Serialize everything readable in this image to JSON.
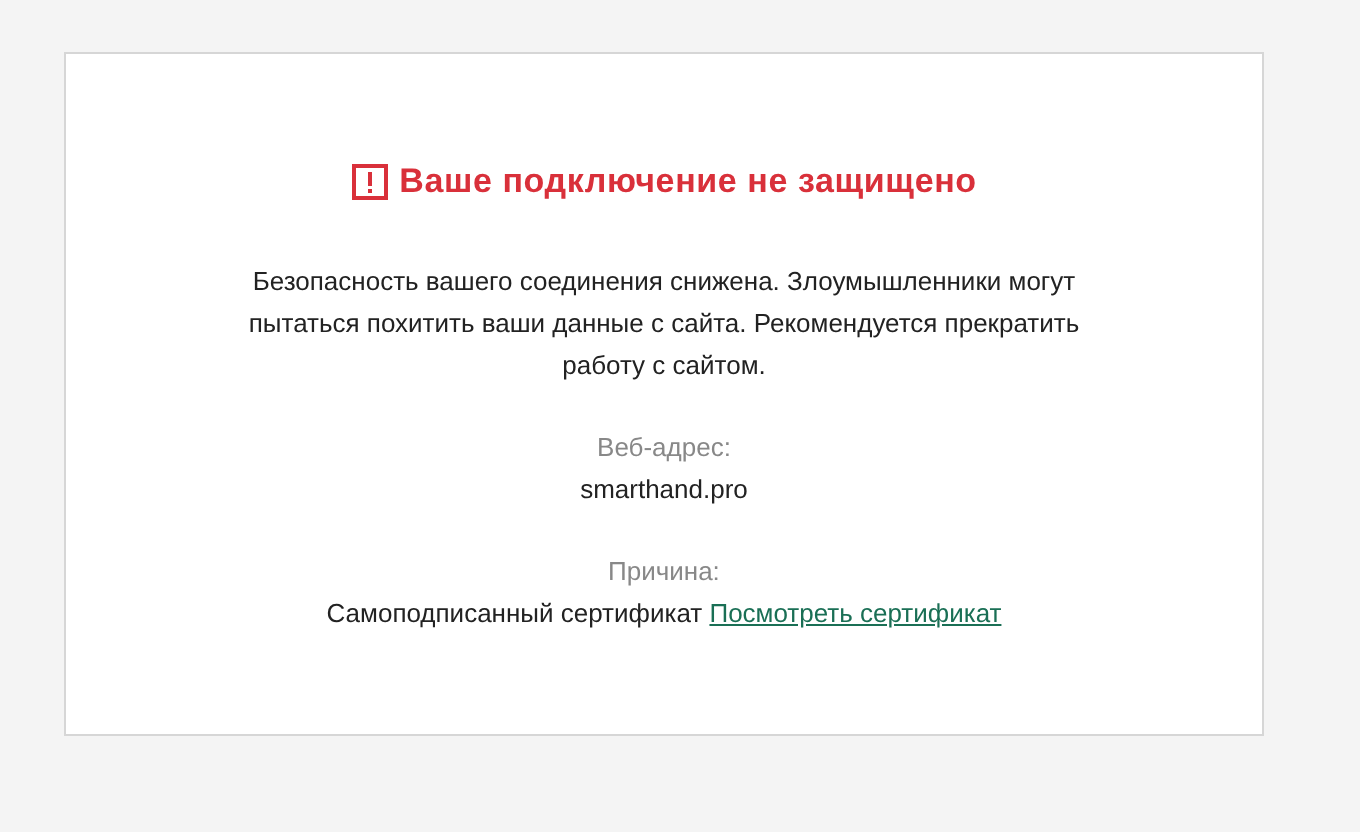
{
  "warning": {
    "title": "Ваше подключение не защищено",
    "message": "Безопасность вашего соединения снижена. Злоумышленники могут пытаться похитить ваши данные с сайта. Рекомендуется прекратить работу с сайтом.",
    "fields": [
      {
        "label": "Веб-адрес:",
        "value": "smarthand.pro"
      },
      {
        "label": "Причина:",
        "value": "Самоподписанный сертификат",
        "link": "Посмотреть сертификат"
      }
    ]
  }
}
